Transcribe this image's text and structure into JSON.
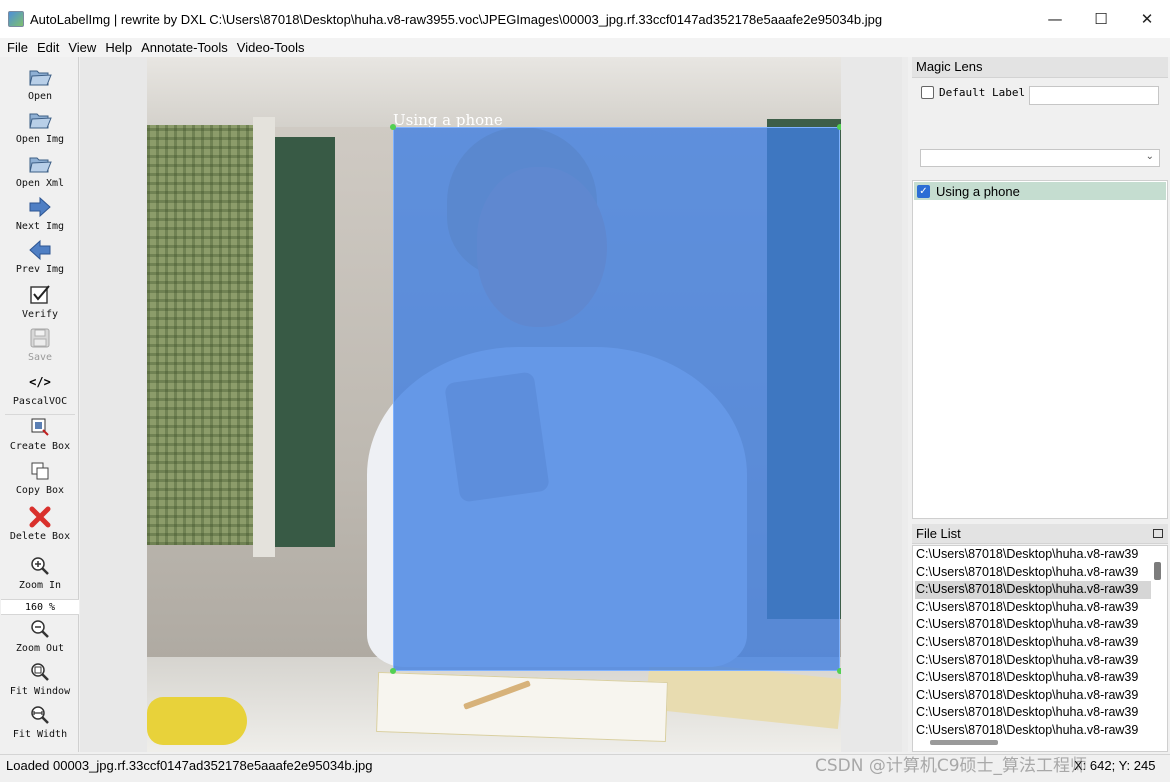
{
  "window": {
    "title": "AutoLabelImg | rewrite by DXL C:\\Users\\87018\\Desktop\\huha.v8-raw3955.voc\\JPEGImages\\00003_jpg.rf.33ccf0147ad352178e5aaafe2e95034b.jpg",
    "minimize": "—",
    "maximize": "☐",
    "close": "✕"
  },
  "menu": {
    "file": "File",
    "edit": "Edit",
    "view": "View",
    "help": "Help",
    "annotate": "Annotate-Tools",
    "video": "Video-Tools"
  },
  "toolbar": {
    "open": "Open",
    "open_img": "Open Img",
    "open_xml": "Open Xml",
    "next_img": "Next Img",
    "prev_img": "Prev Img",
    "verify": "Verify",
    "save": "Save",
    "format": "PascalVOC",
    "format_icon": "</>",
    "create_box": "Create Box",
    "copy_box": "Copy Box",
    "delete_box": "Delete Box",
    "zoom_in": "Zoom In",
    "zoom_value": "160 %",
    "zoom_out": "Zoom Out",
    "fit_window": "Fit Window",
    "fit_width": "Fit Width"
  },
  "canvas": {
    "box_label": "Using a phone"
  },
  "magic_lens": {
    "title": "Magic Lens",
    "default_label_text": "Default Label",
    "default_label_value": "",
    "combo_value": ""
  },
  "labels": {
    "items": [
      {
        "text": "Using a phone",
        "checked": true
      }
    ]
  },
  "file_list": {
    "title": "File List",
    "rows": [
      "C:\\Users\\87018\\Desktop\\huha.v8-raw39",
      "C:\\Users\\87018\\Desktop\\huha.v8-raw39",
      "C:\\Users\\87018\\Desktop\\huha.v8-raw39",
      "C:\\Users\\87018\\Desktop\\huha.v8-raw39",
      "C:\\Users\\87018\\Desktop\\huha.v8-raw39",
      "C:\\Users\\87018\\Desktop\\huha.v8-raw39",
      "C:\\Users\\87018\\Desktop\\huha.v8-raw39",
      "C:\\Users\\87018\\Desktop\\huha.v8-raw39",
      "C:\\Users\\87018\\Desktop\\huha.v8-raw39",
      "C:\\Users\\87018\\Desktop\\huha.v8-raw39",
      "C:\\Users\\87018\\Desktop\\huha.v8-raw39"
    ],
    "selected_index": 2
  },
  "status": {
    "message": "Loaded 00003_jpg.rf.33ccf0147ad352178e5aaafe2e95034b.jpg",
    "coords": "X: 642; Y: 245"
  },
  "watermark": "CSDN @计算机C9硕士_算法工程师",
  "colors": {
    "bbox_fill": "#3f7fe3",
    "handle": "#52d052",
    "label_selected": "#c5ddd0"
  }
}
